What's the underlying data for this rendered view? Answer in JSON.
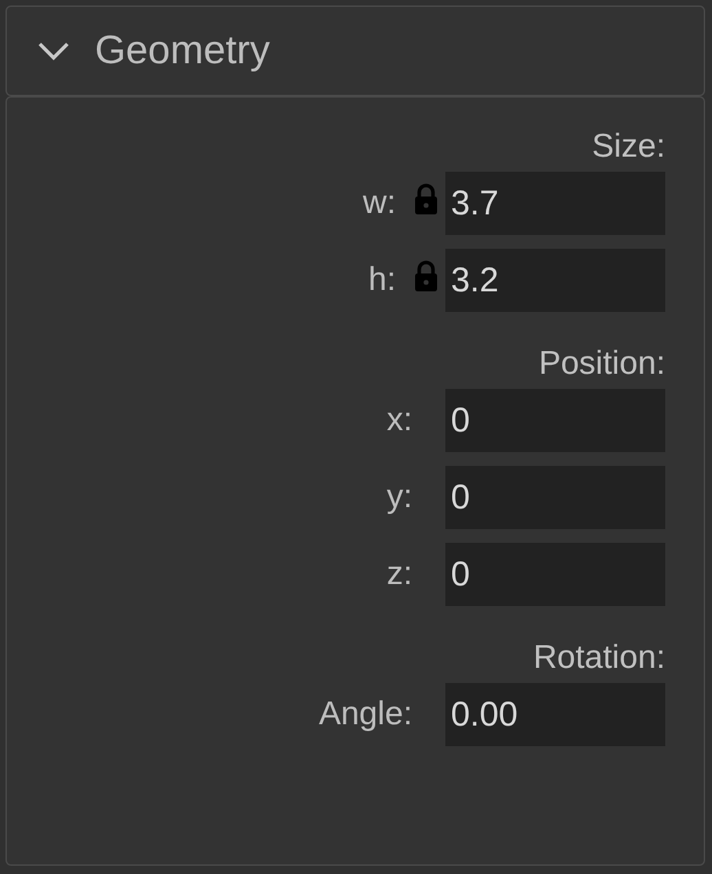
{
  "panel": {
    "title": "Geometry",
    "expanded": true
  },
  "sections": [
    {
      "title": "Size:",
      "rows": [
        {
          "label": "w:",
          "value": "3.7",
          "locked": true
        },
        {
          "label": "h:",
          "value": "3.2",
          "locked": true
        }
      ]
    },
    {
      "title": "Position:",
      "rows": [
        {
          "label": "x:",
          "value": "0",
          "locked": false
        },
        {
          "label": "y:",
          "value": "0",
          "locked": false
        },
        {
          "label": "z:",
          "value": "0",
          "locked": false
        }
      ]
    },
    {
      "title": "Rotation:",
      "rows": [
        {
          "label": "Angle:",
          "value": "0.00",
          "locked": false
        }
      ]
    }
  ]
}
